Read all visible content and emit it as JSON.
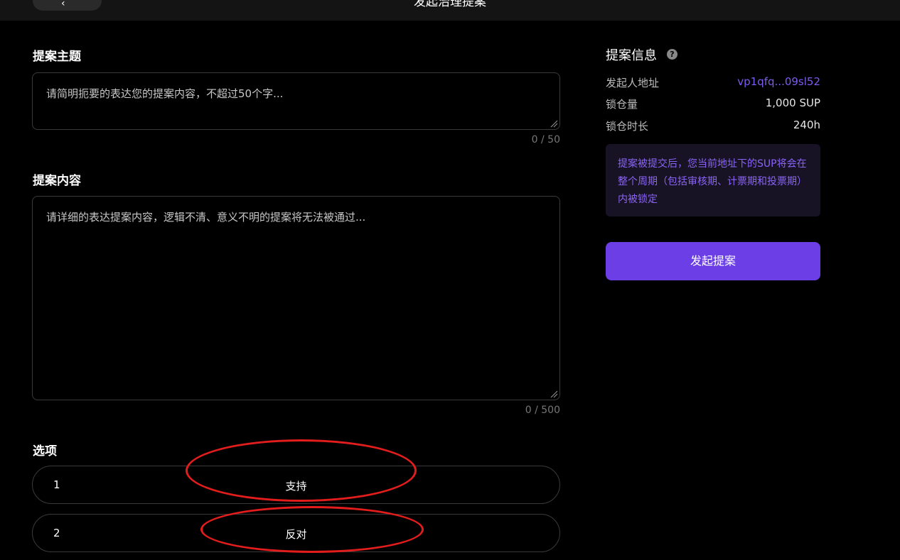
{
  "header": {
    "title": "发起治理提案",
    "back_icon": "chevron-left-icon"
  },
  "form": {
    "subject": {
      "label": "提案主题",
      "placeholder": "请简明扼要的表达您的提案内容，不超过50个字...",
      "counter": "0 / 50"
    },
    "content": {
      "label": "提案内容",
      "placeholder": "请详细的表达提案内容，逻辑不清、意义不明的提案将无法被通过...",
      "counter": "0 / 500"
    },
    "options": {
      "label": "选项",
      "items": [
        {
          "num": "1",
          "text": "支持"
        },
        {
          "num": "2",
          "text": "反对"
        }
      ]
    }
  },
  "info": {
    "title": "提案信息",
    "help_icon": "question-circle-icon",
    "rows": [
      {
        "key": "发起人地址",
        "value": "vp1qfq...09sl52"
      },
      {
        "key": "锁仓量",
        "value": "1,000 SUP"
      },
      {
        "key": "锁仓时长",
        "value": "240h"
      }
    ],
    "notice": "提案被提交后，您当前地址下的SUP将会在整个周期（包括审核期、计票期和投票期）内被锁定",
    "submit_label": "发起提案"
  },
  "colors": {
    "accent": "#6c3fe6",
    "link": "#7b5cf0",
    "annotation": "#e31c1c"
  }
}
